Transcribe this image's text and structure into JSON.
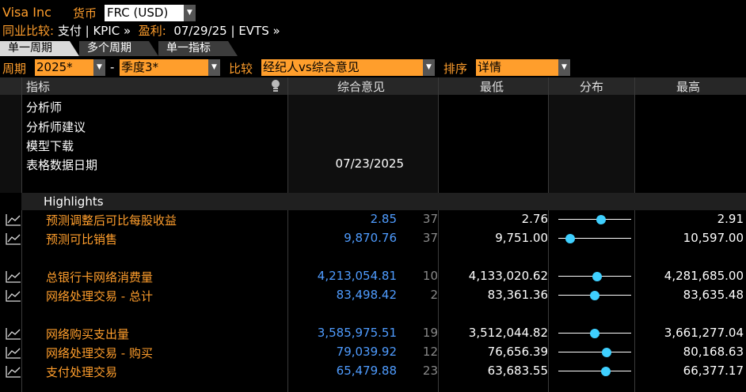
{
  "header": {
    "company": "Visa Inc",
    "currency_label": "货币",
    "currency_value": "FRC (USD)",
    "peer_label": "同业比较:",
    "peer_value": "支付",
    "kpic": "KPIC »",
    "earnings_label": "盈利:",
    "earnings_date": "07/29/25",
    "evts": "EVTS »"
  },
  "tabs": [
    {
      "label": "单一周期",
      "active": true
    },
    {
      "label": "多个周期",
      "active": false
    },
    {
      "label": "单一指标",
      "active": false
    }
  ],
  "filters": {
    "period_label": "周期",
    "year": "2025*",
    "dash": "-",
    "quarter": "季度3*",
    "compare_label": "比较",
    "compare_value": "经纪人vs综合意见",
    "sort_label": "排序",
    "sort_value": "详情"
  },
  "columns": {
    "indicator": "指标",
    "consensus": "综合意见",
    "low": "最低",
    "distribution": "分布",
    "high": "最高"
  },
  "meta": {
    "analyst": "分析师",
    "analyst_rec": "分析师建议",
    "model_download": "模型下载",
    "table_date_label": "表格数据日期",
    "table_date_value": "07/23/2025"
  },
  "highlights_label": "Highlights",
  "rows": [
    {
      "label": "预测调整后可比每股收益",
      "consensus": "2.85",
      "count": "37",
      "low": "2.76",
      "high": "2.91",
      "dot": 0.6
    },
    {
      "label": "预测可比销售",
      "consensus": "9,870.76",
      "count": "37",
      "low": "9,751.00",
      "high": "10,597.00",
      "dot": 0.13
    },
    {
      "label": "总银行卡网络消费量",
      "consensus": "4,213,054.81",
      "count": "10",
      "low": "4,133,020.62",
      "high": "4,281,685.00",
      "dot": 0.54
    },
    {
      "label": "网络处理交易 - 总计",
      "consensus": "83,498.42",
      "count": "2",
      "low": "83,361.36",
      "high": "83,635.48",
      "dot": 0.5
    },
    {
      "label": "网络购买支出量",
      "consensus": "3,585,975.51",
      "count": "19",
      "low": "3,512,044.82",
      "high": "3,661,277.04",
      "dot": 0.5
    },
    {
      "label": "网络处理交易 - 购买",
      "consensus": "79,039.92",
      "count": "12",
      "low": "76,656.39",
      "high": "80,168.63",
      "dot": 0.68
    },
    {
      "label": "支付处理交易",
      "consensus": "65,479.88",
      "count": "23",
      "low": "63,683.55",
      "high": "66,377.17",
      "dot": 0.67
    }
  ]
}
